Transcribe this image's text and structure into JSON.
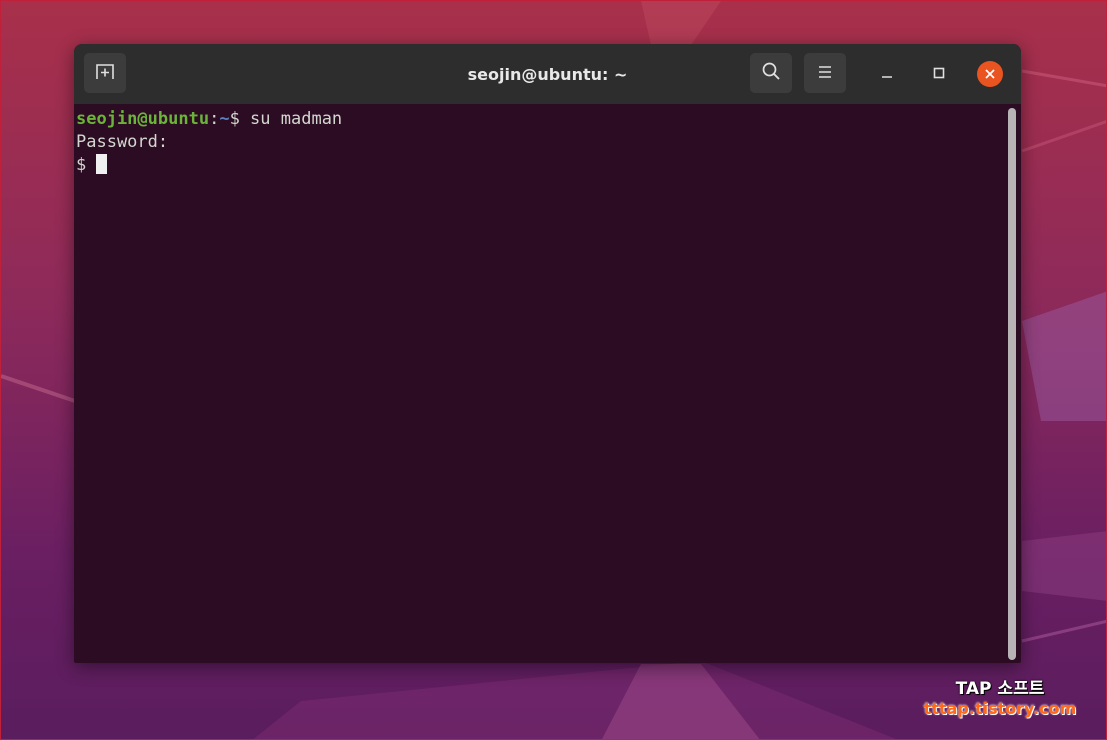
{
  "window": {
    "title": "seojin@ubuntu: ~"
  },
  "icons": {
    "new_tab": "new-tab-icon",
    "search": "search-icon",
    "menu": "hamburger-menu-icon",
    "minimize": "minimize-icon",
    "maximize": "maximize-icon",
    "close": "close-icon"
  },
  "terminal": {
    "line1": {
      "user_host": "seojin@ubuntu",
      "colon": ":",
      "path": "~",
      "dollar": "$",
      "command": " su madman"
    },
    "line2": "Password:",
    "line3": "$ "
  },
  "watermark": {
    "title": "TAP 소프트",
    "url": "tttap.tistory.com"
  },
  "colors": {
    "terminal_bg": "#2c0c22",
    "titlebar_bg": "#2d2d2d",
    "prompt_user": "#6bb33a",
    "prompt_path": "#5b7fc0",
    "close_button": "#e95420"
  }
}
